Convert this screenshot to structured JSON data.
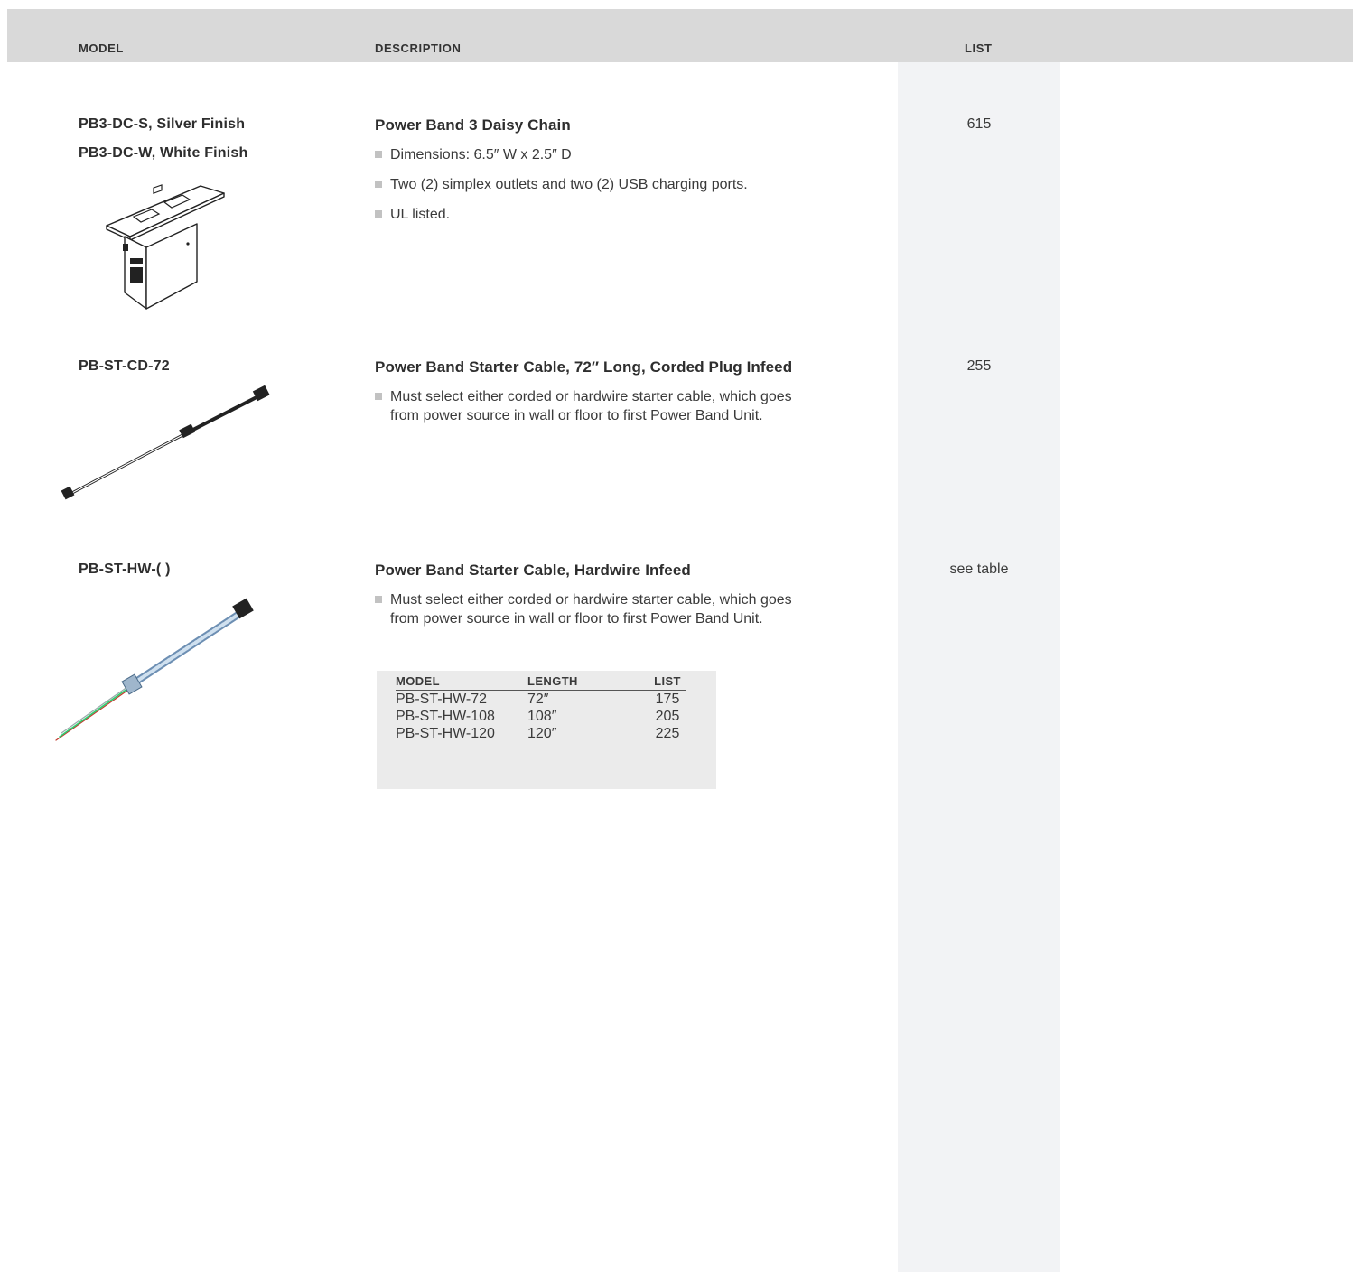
{
  "header": {
    "col_model": "MODEL",
    "col_description": "DESCRIPTION",
    "col_list": "LIST"
  },
  "products": [
    {
      "models": [
        "PB3-DC-S, Silver Finish",
        "PB3-DC-W, White Finish"
      ],
      "title": "Power Band 3 Daisy Chain",
      "bullets": [
        "Dimensions: 6.5″ W x 2.5″ D",
        "Two (2) simplex outlets and two (2) USB charging ports.",
        "UL listed."
      ],
      "price": "615",
      "image_icon": "power-band-unit-icon"
    },
    {
      "models": [
        "PB-ST-CD-72"
      ],
      "title": "Power Band Starter Cable, 72″ Long, Corded Plug Infeed",
      "bullets": [
        "Must select either corded or hardwire starter cable, which goes from power source in wall or floor to first Power Band Unit."
      ],
      "price": "255",
      "image_icon": "corded-cable-icon"
    },
    {
      "models": [
        "PB-ST-HW-( )"
      ],
      "title": "Power Band Starter Cable, Hardwire Infeed",
      "bullets": [
        "Must select either corded or hardwire starter cable, which goes from power source in wall or floor to first Power Band Unit."
      ],
      "price": "see table",
      "image_icon": "hardwire-cable-icon",
      "subtable": {
        "headers": [
          "MODEL",
          "LENGTH",
          "LIST"
        ],
        "rows": [
          [
            "PB-ST-HW-72",
            "72″",
            "175"
          ],
          [
            "PB-ST-HW-108",
            "108″",
            "205"
          ],
          [
            "PB-ST-HW-120",
            "120″",
            "225"
          ]
        ]
      }
    }
  ],
  "colors": {
    "header_bar": "#d9d9d9",
    "list_column": "#f2f3f5",
    "subtable_bg": "#ebebeb",
    "bullet": "#c2c2c2"
  }
}
